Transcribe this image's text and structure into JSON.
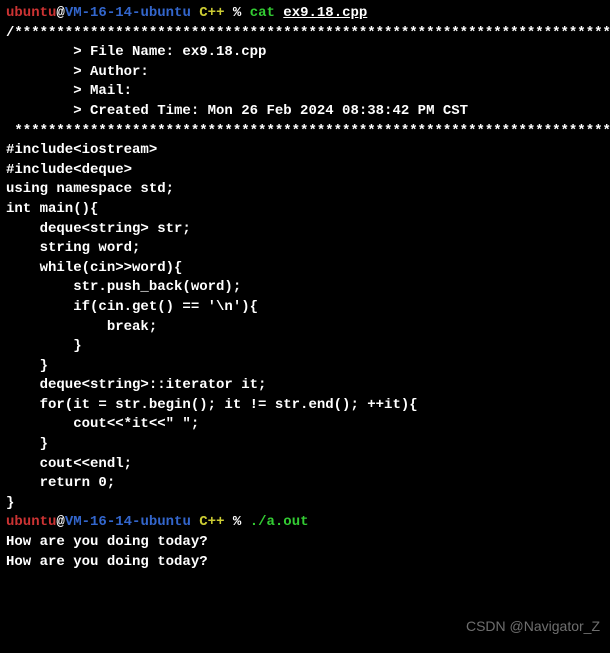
{
  "prompt": {
    "user": "ubuntu",
    "at": "@",
    "host": "VM-16-14-ubuntu",
    "dir": " C++ ",
    "pct": "% "
  },
  "cmd1": {
    "name": "cat ",
    "arg": "ex9.18.cpp"
  },
  "cmd2": {
    "name": "./a.out"
  },
  "code": {
    "l01": "/*************************************************************************",
    "l02": "        > File Name: ex9.18.cpp",
    "l03": "        > Author:",
    "l04": "        > Mail:",
    "l05": "        > Created Time: Mon 26 Feb 2024 08:38:42 PM CST",
    "l06": " ************************************************************************/",
    "l07": "",
    "l08": "#include<iostream>",
    "l09": "#include<deque>",
    "l10": "using namespace std;",
    "l11": "",
    "l12": "int main(){",
    "l13": "    deque<string> str;",
    "l14": "    string word;",
    "l15": "",
    "l16": "    while(cin>>word){",
    "l17": "        str.push_back(word);",
    "l18": "        if(cin.get() == '\\n'){",
    "l19": "            break;",
    "l20": "        }",
    "l21": "    }",
    "l22": "",
    "l23": "    deque<string>::iterator it;",
    "l24": "    for(it = str.begin(); it != str.end(); ++it){",
    "l25": "        cout<<*it<<\" \";",
    "l26": "    }",
    "l27": "    cout<<endl;",
    "l28": "",
    "l29": "    return 0;",
    "l30": "}"
  },
  "io": {
    "in": "How are you doing today?",
    "out": "How are you doing today?"
  },
  "watermark": "CSDN @Navigator_Z"
}
